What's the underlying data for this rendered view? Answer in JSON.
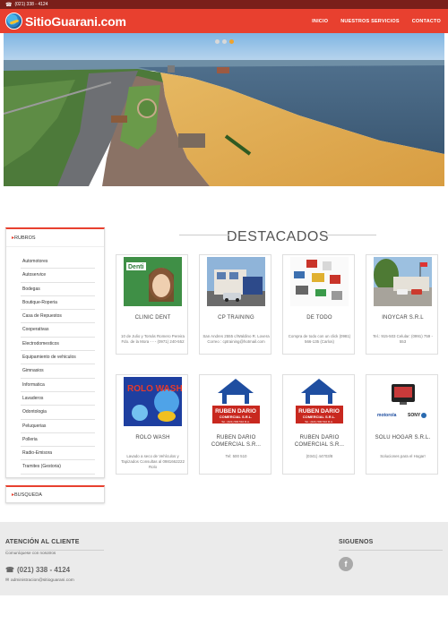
{
  "topbar": {
    "phone": "(021) 338 - 4124"
  },
  "header": {
    "logo_text": "SitioGuarani.com",
    "nav": [
      "INICIO",
      "NUESTROS SERVICIOS",
      "CONTACTO"
    ]
  },
  "carousel": {
    "slide_count": 3,
    "active_index": 2
  },
  "sidebar": {
    "rubros_title": "RUBROS",
    "rubros": [
      "Automotores",
      "Autoservice",
      "Bodegas",
      "Boutique-Roperia",
      "Casa de Repuestos",
      "Cooperativas",
      "Electrodomesticos",
      "Equipamiento de vehiculos",
      "Gimnasios",
      "Informatica",
      "Lavaderos",
      "Odontologia",
      "Peluquerias",
      "Polleria",
      "Radio-Emisora",
      "Tramites (Gestoria)"
    ],
    "busqueda_title": "BUSQUEDA"
  },
  "destacados": {
    "title": "DESTACADOS",
    "items": [
      {
        "name": "CLINIC DENT",
        "desc": "10 de Julio y Tomás Romero Pereira Fdo. de la Mora - - - (0971) 240-552"
      },
      {
        "name": "CP TRAINING",
        "desc": "San Andres 2555 c/Waldino R. Lovera Correo : cptraining@hotmail.com"
      },
      {
        "name": "DE TODO",
        "desc": "Compra de todo con un click (0981) 566-135 (Carlos)"
      },
      {
        "name": "INOYCAR S.R.L",
        "desc": "Tel.: 915-503 Celular: (0991) 759 - 553"
      },
      {
        "name": "ROLO WASH",
        "desc": "Lavado a seco de Vehículos y Tapizados Consultas al 0981662222 Rolo"
      },
      {
        "name": "RUBEN DARIO COMERCIAL S.R...",
        "desc": "Tel: 500 510"
      },
      {
        "name": "RUBEN DARIO COMERCIAL S.R...",
        "desc": "(0341) 44703/8"
      },
      {
        "name": "SOLU HOGAR S.R.L.",
        "desc": "Soluciones para el Hogar!"
      }
    ],
    "logo_texts": {
      "clinic_dent": "Denti",
      "rolo_wash": "ROLO WASH",
      "ruben_dario_main": "RUBEN DARIO",
      "ruben_dario_sub": "COMERCIAL S.R.L.",
      "ruben_dario_phone": "Tel.: (021) 500 510 R.A.",
      "solu_brands": [
        "motorola",
        "SONY"
      ]
    }
  },
  "footer": {
    "atencion_title": "ATENCIÓN AL CLIENTE",
    "atencion_sub": "Comuníquese con nosotros",
    "phone": "(021) 338 - 4124",
    "email": "administracion@sitioguarani.com",
    "siguenos_title": "SIGUENOS",
    "facebook_glyph": "f"
  },
  "colors": {
    "brand": "#e8402f",
    "topbar": "#7a1f1a",
    "footer_bg": "#ebebeb"
  }
}
